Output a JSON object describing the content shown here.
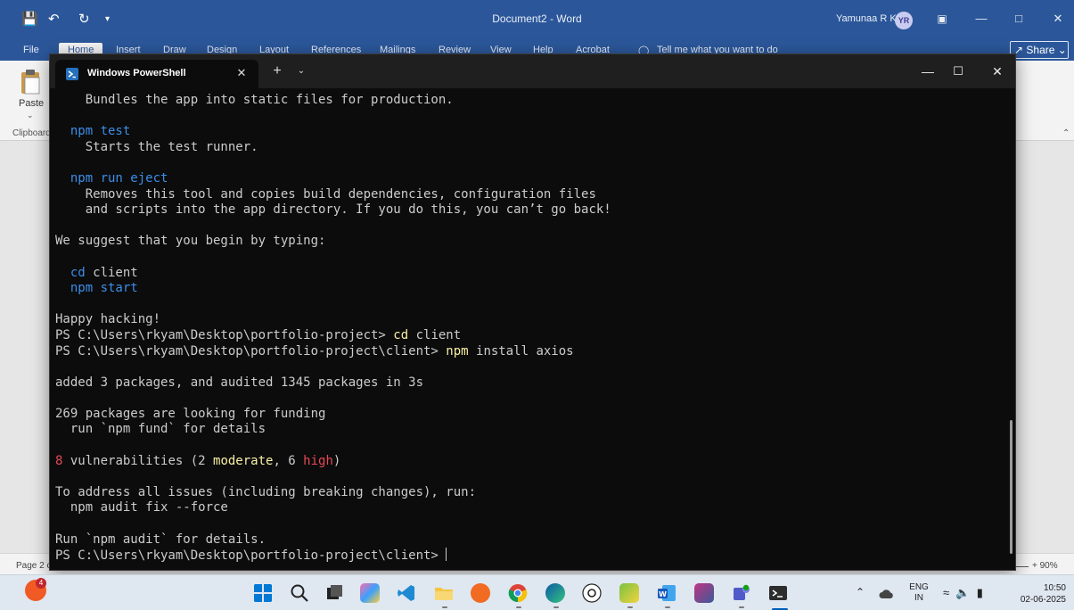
{
  "word": {
    "title": "Document2 - Word",
    "user_name": "Yamunaa R K",
    "user_initials": "YR",
    "tabs": [
      "File",
      "Home",
      "Insert",
      "Draw",
      "Design",
      "Layout",
      "References",
      "Mailings",
      "Review",
      "View",
      "Help",
      "Acrobat"
    ],
    "tell_me": "Tell me what you want to do",
    "share": "Share",
    "paste": "Paste",
    "clipboard": "Clipboard",
    "page_status": "Page 2 c",
    "zoom": "90%"
  },
  "powershell": {
    "tab_title": "Windows PowerShell",
    "lines": [
      [
        {
          "t": "    Bundles the app into static files for production."
        }
      ],
      [
        {
          "t": ""
        }
      ],
      [
        {
          "t": "  "
        },
        {
          "t": "npm test",
          "c": "blue"
        }
      ],
      [
        {
          "t": "    Starts the test runner."
        }
      ],
      [
        {
          "t": ""
        }
      ],
      [
        {
          "t": "  "
        },
        {
          "t": "npm run eject",
          "c": "blue"
        }
      ],
      [
        {
          "t": "    Removes this tool and copies build dependencies, configuration files"
        }
      ],
      [
        {
          "t": "    and scripts into the app directory. If you do this, you can’t go back!"
        }
      ],
      [
        {
          "t": ""
        }
      ],
      [
        {
          "t": "We suggest that you begin by typing:"
        }
      ],
      [
        {
          "t": ""
        }
      ],
      [
        {
          "t": "  "
        },
        {
          "t": "cd",
          "c": "blue"
        },
        {
          "t": " client"
        }
      ],
      [
        {
          "t": "  "
        },
        {
          "t": "npm start",
          "c": "blue"
        }
      ],
      [
        {
          "t": ""
        }
      ],
      [
        {
          "t": "Happy hacking!"
        }
      ],
      [
        {
          "t": "PS C:\\Users\\rkyam\\Desktop\\portfolio-project> "
        },
        {
          "t": "cd",
          "c": "cmd"
        },
        {
          "t": " client"
        }
      ],
      [
        {
          "t": "PS C:\\Users\\rkyam\\Desktop\\portfolio-project\\client> "
        },
        {
          "t": "npm",
          "c": "cmd"
        },
        {
          "t": " install axios"
        }
      ],
      [
        {
          "t": ""
        }
      ],
      [
        {
          "t": "added 3 packages, and audited 1345 packages in 3s"
        }
      ],
      [
        {
          "t": ""
        }
      ],
      [
        {
          "t": "269 packages are looking for funding"
        }
      ],
      [
        {
          "t": "  run `npm fund` for details"
        }
      ],
      [
        {
          "t": ""
        }
      ],
      [
        {
          "t": "8",
          "c": "red"
        },
        {
          "t": " vulnerabilities (2 "
        },
        {
          "t": "moderate",
          "c": "yellow"
        },
        {
          "t": ", 6 "
        },
        {
          "t": "high",
          "c": "red"
        },
        {
          "t": ")"
        }
      ],
      [
        {
          "t": ""
        }
      ],
      [
        {
          "t": "To address all issues (including breaking changes), run:"
        }
      ],
      [
        {
          "t": "  npm audit fix --force"
        }
      ],
      [
        {
          "t": ""
        }
      ],
      [
        {
          "t": "Run `npm audit` for details."
        }
      ],
      [
        {
          "t": "PS C:\\Users\\rkyam\\Desktop\\portfolio-project\\client> "
        }
      ]
    ]
  },
  "taskbar": {
    "notification_count": "4",
    "language_line1": "ENG",
    "language_line2": "IN",
    "time": "10:50",
    "date": "02-06-2025"
  }
}
